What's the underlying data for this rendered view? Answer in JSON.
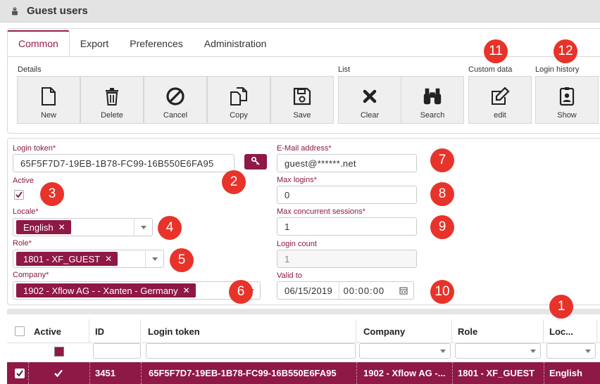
{
  "window": {
    "title": "Guest users"
  },
  "tabs": [
    {
      "label": "Common",
      "active": true
    },
    {
      "label": "Export"
    },
    {
      "label": "Preferences"
    },
    {
      "label": "Administration"
    }
  ],
  "toolbar": {
    "groups": {
      "details": "Details",
      "list": "List",
      "custom": "Custom data",
      "history": "Login history"
    },
    "buttons": {
      "new": "New",
      "delete": "Delete",
      "cancel": "Cancel",
      "copy": "Copy",
      "save": "Save",
      "clear": "Clear",
      "search": "Search",
      "edit": "edit",
      "show": "Show"
    }
  },
  "form": {
    "login_token": {
      "label": "Login token",
      "value": "65F5F7D7-19EB-1B78-FC99-16B550E6FA95"
    },
    "active": {
      "label": "Active",
      "checked": true
    },
    "locale": {
      "label": "Locale",
      "value": "English"
    },
    "role": {
      "label": "Role",
      "value": "1801 - XF_GUEST"
    },
    "company": {
      "label": "Company",
      "value": "1902 - Xflow AG - - Xanten - Germany"
    },
    "email": {
      "label": "E-Mail address",
      "value": "guest@******.net"
    },
    "max_logins": {
      "label": "Max logins",
      "value": "0"
    },
    "max_sessions": {
      "label": "Max concurrent sessions",
      "value": "1"
    },
    "login_count": {
      "label": "Login count",
      "value": "1"
    },
    "valid_to": {
      "label": "Valid to",
      "date": "06/15/2019",
      "time": "00:00:00"
    },
    "required_mark": "*"
  },
  "badges": [
    "1",
    "2",
    "3",
    "4",
    "5",
    "6",
    "7",
    "8",
    "9",
    "10",
    "11",
    "12"
  ],
  "grid": {
    "headers": {
      "active": "Active",
      "id": "ID",
      "token": "Login token",
      "company": "Company",
      "role": "Role",
      "locale": "Loc..."
    },
    "row": {
      "id": "3451",
      "token": "65F5F7D7-19EB-1B78-FC99-16B550E6FA95",
      "company": "1902 - Xflow AG -...",
      "role": "1801 - XF_GUEST",
      "locale": "English"
    }
  },
  "colors": {
    "accent": "#8e1846",
    "badge": "#e7332a",
    "label": "#8b1a3f"
  }
}
